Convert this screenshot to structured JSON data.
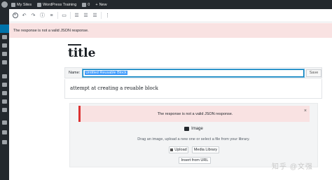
{
  "adminbar": {
    "my_sites": "My Sites",
    "site_name": "WordPress Training",
    "comments_count": "0",
    "new_label": "New",
    "user_icon": "avatar"
  },
  "toolbar": {
    "icons": [
      "add-block-icon",
      "undo-icon",
      "redo-icon",
      "info-icon",
      "block-navigation-icon",
      "reusable-block-icon",
      "align-left-icon",
      "align-center-icon",
      "align-right-icon",
      "more-options-icon"
    ]
  },
  "notice_top": {
    "text": "The response is not a valid JSON response."
  },
  "post": {
    "title": "title"
  },
  "reusable": {
    "name_label": "Name:",
    "name_value": "Untitled Reusable Block",
    "save_label": "Save",
    "paragraph": "attempt at creating a reuable block"
  },
  "image_block": {
    "notice_text": "The response is not a valid JSON response.",
    "close_icon": "×",
    "label": "Image",
    "instructions": "Drag an image, upload a new one or select a file from your library.",
    "upload_label": "Upload",
    "media_label": "Media Library",
    "url_label": "Insert from URL"
  },
  "watermark": "知乎 @文强",
  "colors": {
    "notice_bg": "#f9e2e2",
    "notice_border": "#dc3232",
    "accent": "#0073aa",
    "adminbar": "#23282d"
  }
}
